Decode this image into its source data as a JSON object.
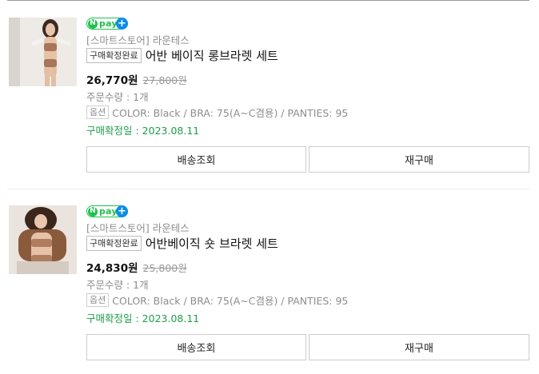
{
  "orders": [
    {
      "store": "[스마트스토어] 라운테스",
      "npay": {
        "n": "N",
        "pay": "pay",
        "plus": "+"
      },
      "status_badge": "구매확정완료",
      "title": "어반 베이직 롱브라렛 세트",
      "price": "26,770원",
      "original_price": "27,800원",
      "quantity": "주문수량 : 1개",
      "option_badge": "옵션",
      "option_text": "COLOR: Black / BRA: 75(A~C겸용) / PANTIES: 95",
      "confirm_date": "구매확정일 : 2023.08.11",
      "buttons": {
        "tracking": "배송조회",
        "rebuy": "재구매"
      }
    },
    {
      "store": "[스마트스토어] 라운테스",
      "npay": {
        "n": "N",
        "pay": "pay",
        "plus": "+"
      },
      "status_badge": "구매확정완료",
      "title": "어반베이직 숏 브라렛 세트",
      "price": "24,830원",
      "original_price": "25,800원",
      "quantity": "주문수량 : 1개",
      "option_badge": "옵션",
      "option_text": "COLOR: Black / BRA: 75(A~C겸용) / PANTIES: 95",
      "confirm_date": "구매확정일 : 2023.08.11",
      "buttons": {
        "tracking": "배송조회",
        "rebuy": "재구매"
      }
    }
  ],
  "colors": {
    "npay_green": "#1dc24b",
    "plus_blue": "#0d8ce8",
    "confirm_green": "#1e9e4a",
    "muted_text": "#8d8d8d"
  }
}
